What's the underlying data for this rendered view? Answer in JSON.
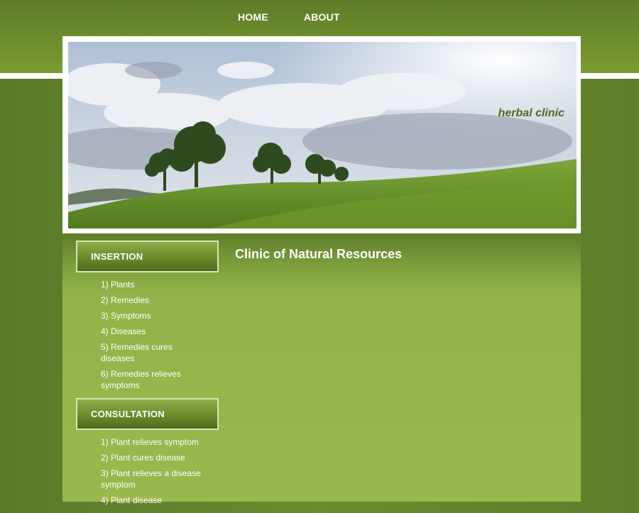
{
  "nav": {
    "home": "HOME",
    "about": "ABOUT"
  },
  "header": {
    "tagline": "herbal clinic"
  },
  "sidebar": {
    "insertion": {
      "title": "INSERTION",
      "items": [
        "1) Plants",
        "2) Remedies",
        "3) Symptoms",
        "4) Diseases",
        "5) Remedies cures diseases",
        "6) Remedies relieves symptoms"
      ]
    },
    "consultation": {
      "title": "CONSULTATION",
      "items": [
        "1) Plant relieves symptom",
        "2) Plant cures disease",
        "3) Plant relieves a disease symptom",
        "4) Plant disease"
      ]
    }
  },
  "main": {
    "title": "Clinic of Natural Resources"
  },
  "colors": {
    "accent": "#6b8a2c",
    "panel": "#99b84d",
    "tagline": "#4d6b1f"
  }
}
